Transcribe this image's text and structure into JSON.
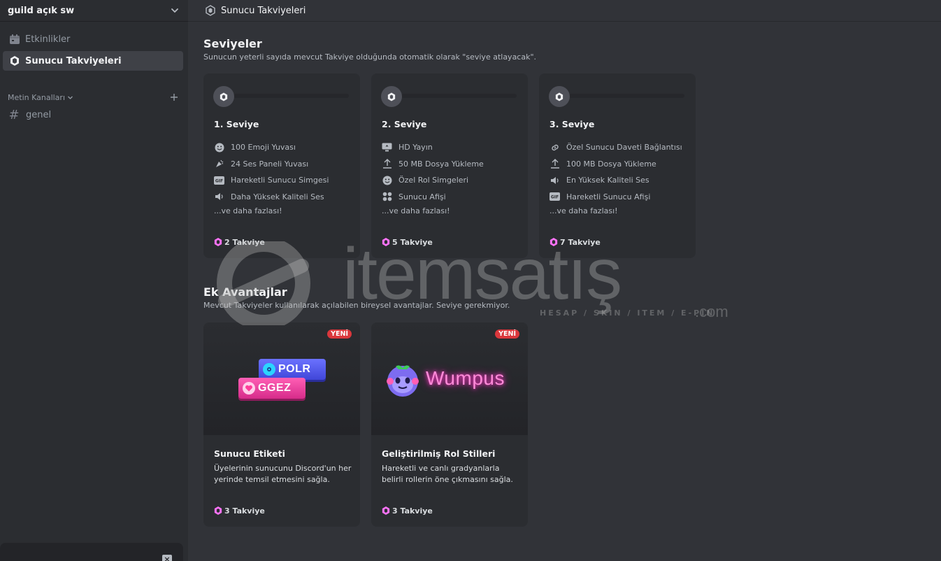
{
  "sidebar": {
    "guild_name": "guild açık sw",
    "items": [
      {
        "label": "Etkinlikler"
      },
      {
        "label": "Sunucu Takviyeleri"
      }
    ],
    "category": "Metin Kanalları",
    "channel": "genel"
  },
  "topbar": {
    "title": "Sunucu Takviyeleri"
  },
  "tiers_section": {
    "title": "Seviyeler",
    "description": "Sunucun yeterli sayıda mevcut Takviye olduğunda otomatik olarak \"seviye atlayacak\".",
    "tiers": [
      {
        "name": "1. Seviye",
        "perks": [
          "100 Emoji Yuvası",
          "24 Ses Paneli Yuvası",
          "Hareketli Sunucu Simgesi",
          "Daha Yüksek Kaliteli Ses"
        ],
        "more": "...ve daha fazlası!",
        "cost": "2 Takviye"
      },
      {
        "name": "2. Seviye",
        "perks": [
          "HD Yayın",
          "50 MB Dosya Yükleme",
          "Özel Rol Simgeleri",
          "Sunucu Afişi"
        ],
        "more": "...ve daha fazlası!",
        "cost": "5 Takviye"
      },
      {
        "name": "3. Seviye",
        "perks": [
          "Özel Sunucu Daveti Bağlantısı",
          "100 MB Dosya Yükleme",
          "En Yüksek Kaliteli Ses",
          "Hareketli Sunucu Afişi"
        ],
        "more": "...ve daha fazlası!",
        "cost": "7 Takviye"
      }
    ]
  },
  "extras_section": {
    "title": "Ek Avantajlar",
    "description": "Mevcut Takviyeler kullanılarak açılabilen bireysel avantajlar. Seviye gerekmiyor.",
    "cards": [
      {
        "badge": "YENİ",
        "title": "Sunucu Etiketi",
        "description": "Üyelerinin sunucunu Discord'un her yerinde temsil etmesini sağla.",
        "cost": "3 Takviye",
        "art_tags": [
          "POLR",
          "GGEZ"
        ]
      },
      {
        "badge": "YENİ",
        "title": "Geliştirilmiş Rol Stilleri",
        "description": "Hareketli ve canlı gradyanlarla belirli rollerin öne çıkmasını sağla.",
        "cost": "3 Takviye",
        "art_text": "Wumpus"
      }
    ]
  },
  "watermark": {
    "brand": "itemsatış",
    "tagline": "HESAP / SKIN / ITEM / E-PIN",
    "tld": ".com"
  },
  "colors": {
    "boost_pink": "#ff73fa",
    "new_badge": "#da373c",
    "bg_main": "#313338",
    "bg_sidebar": "#2b2d31"
  }
}
